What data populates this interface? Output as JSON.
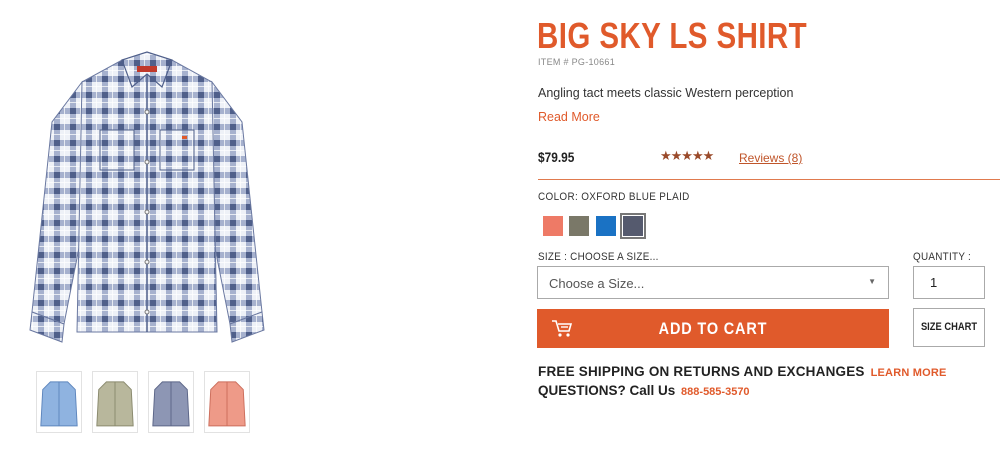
{
  "product": {
    "title": "BIG SKY LS SHIRT",
    "item_number": "ITEM # PG-10661",
    "tagline": "Angling tact meets classic Western perception",
    "read_more": "Read More",
    "price": "$79.95",
    "rating_stars": "★★★★★",
    "rating": 5,
    "reviews_link": "Reviews (8)"
  },
  "color": {
    "label": "COLOR:",
    "selected": "OXFORD BLUE PLAID",
    "swatches": [
      {
        "name": "coral",
        "hex": "#ee7a66"
      },
      {
        "name": "olive",
        "hex": "#7a7868"
      },
      {
        "name": "blue",
        "hex": "#1a72c4"
      },
      {
        "name": "oxford-blue-plaid",
        "hex": "#555a6e"
      }
    ]
  },
  "size": {
    "label": "SIZE :",
    "prompt": "CHOOSE A SIZE...",
    "placeholder": "Choose a Size..."
  },
  "quantity": {
    "label": "QUANTITY :",
    "value": "1"
  },
  "buttons": {
    "add_to_cart": "ADD TO CART",
    "size_chart": "SIZE CHART"
  },
  "shipping": {
    "text": "FREE SHIPPING ON RETURNS AND EXCHANGES",
    "learn_more": "LEARN MORE"
  },
  "questions": {
    "text": "QUESTIONS? Call Us",
    "phone": "888-585-3570"
  },
  "thumbnails": [
    {
      "name": "light-blue-plaid",
      "hex": "#8fb3e0"
    },
    {
      "name": "olive-plaid",
      "hex": "#b8b79c"
    },
    {
      "name": "oxford-blue-plaid",
      "hex": "#8d96b4"
    },
    {
      "name": "coral-plaid",
      "hex": "#ee9a88"
    }
  ],
  "colors": {
    "accent": "#e05a2b",
    "text": "#222222"
  }
}
